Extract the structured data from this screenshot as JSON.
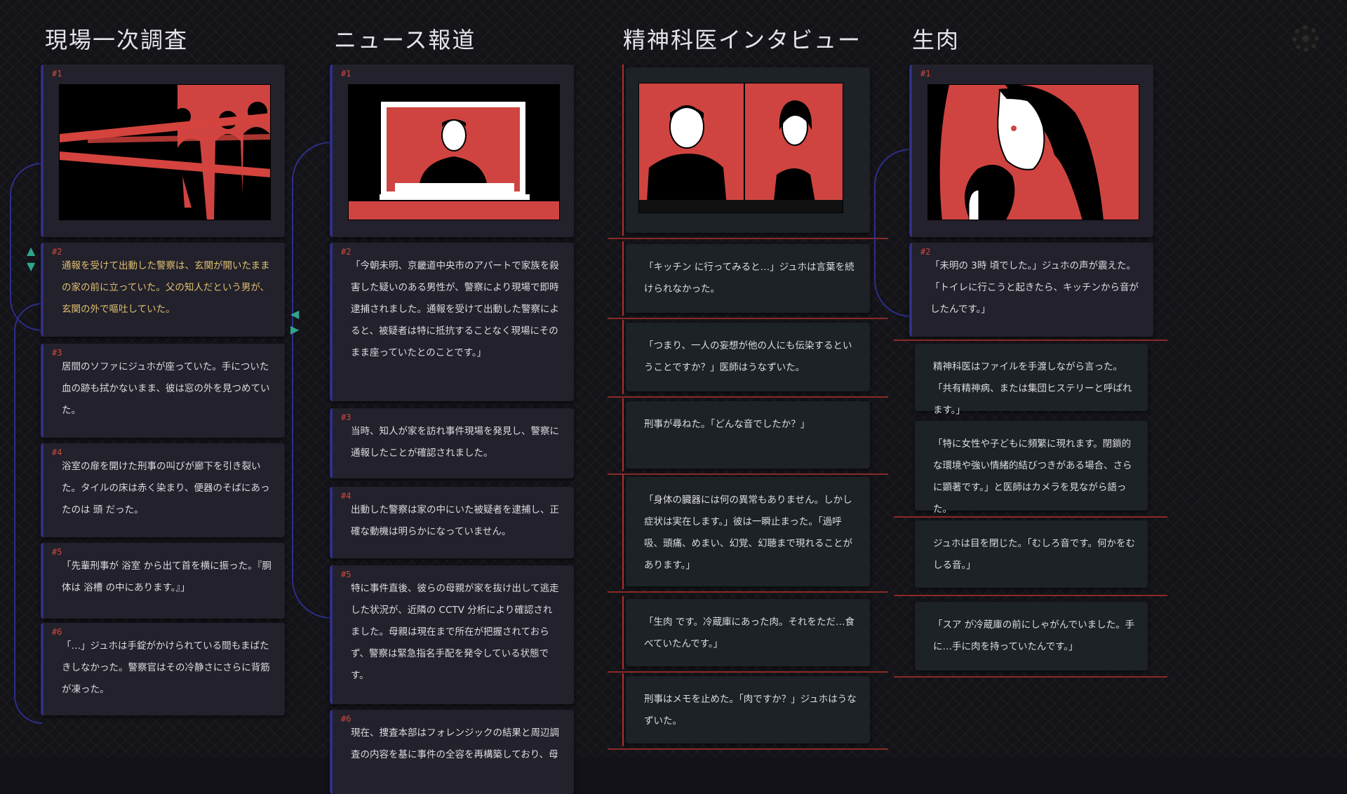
{
  "columns": [
    {
      "title": "現場一次調査",
      "image_label": "#1",
      "cards": [
        {
          "num": "#2",
          "text": "通報を受けて出動した警察は、玄関が開いたままの家の前に立っていた。父の知人だという男が、玄関の外で嘔吐していた。"
        },
        {
          "num": "#3",
          "text": "居間のソファにジュホが座っていた。手についた血の跡も拭かないまま、彼は窓の外を見つめていた。"
        },
        {
          "num": "#4",
          "text": "浴室の扉を開けた刑事の叫びが廊下を引き裂いた。タイルの床は赤く染まり、便器のそばにあったのは 頭 だった。"
        },
        {
          "num": "#5",
          "text": "「先輩刑事が 浴室 から出て首を横に振った。『胴体は 浴槽 の中にあります。』」"
        },
        {
          "num": "#6",
          "text": "「…」ジュホは手錠がかけられている間もまばたきしなかった。警察官はその冷静さにさらに背筋が凍った。"
        }
      ]
    },
    {
      "title": "ニュース報道",
      "image_label": "#1",
      "cards": [
        {
          "num": "#2",
          "text": "「今朝未明、京畿道中央市のアパートで家族を殺害した疑いのある男性が、警察により現場で即時逮捕されました。通報を受けて出動した警察によると、被疑者は特に抵抗することなく現場にそのまま座っていたとのことです。」"
        },
        {
          "num": "#3",
          "text": "当時、知人が家を訪れ事件現場を発見し、警察に通報したことが確認されました。"
        },
        {
          "num": "#4",
          "text": "出動した警察は家の中にいた被疑者を逮捕し、正確な動機は明らかになっていません。"
        },
        {
          "num": "#5",
          "text": "特に事件直後、彼らの母親が家を抜け出して逃走した状況が、近隣の CCTV 分析により確認されました。母親は現在まで所在が把握されておらず、警察は緊急指名手配を発令している状態です。"
        },
        {
          "num": "#6",
          "text": "現在、捜査本部はフォレンジックの結果と周辺調査の内容を基に事件の全容を再構築しており、母"
        }
      ]
    },
    {
      "title": "精神科医インタビュー",
      "cards": [
        {
          "text": "「キッチン に行ってみると…」ジュホは言葉を続けられなかった。"
        },
        {
          "text": "「つまり、一人の妄想が他の人にも伝染するということですか？」医師はうなずいた。"
        },
        {
          "text": "刑事が尋ねた。「どんな音でしたか？」"
        },
        {
          "text": "「身体の臓器には何の異常もありません。しかし症状は実在します。」彼は一瞬止まった。「過呼吸、頭痛、めまい、幻覚、幻聴まで現れることがあります。」"
        },
        {
          "text": "「生肉 です。冷蔵庫にあった肉。それをただ…食べていたんです。」"
        },
        {
          "text": "刑事はメモを止めた。「肉ですか？」ジュホはうなずいた。"
        }
      ]
    },
    {
      "title": "生肉",
      "image_label": "#1",
      "cards": [
        {
          "num": "#2",
          "text": "「未明の 3時 頃でした。」ジュホの声が震えた。「トイレに行こうと起きたら、キッチンから音がしたんです。」"
        },
        {
          "text": "精神科医はファイルを手渡しながら言った。「共有精神病、または集団ヒステリーと呼ばれます。」"
        },
        {
          "text": "「特に女性や子どもに頻繁に現れます。閉鎖的な環境や強い情緒的結びつきがある場合、さらに顕著です。」と医師はカメラを見ながら語った。"
        },
        {
          "text": "ジュホは目を閉じた。「むしろ音です。何かをむしる音。」"
        },
        {
          "text": "「スア が冷蔵庫の前にしゃがんでいました。手に…手に肉を持っていたんです。」"
        }
      ]
    }
  ],
  "icons": {
    "settings": "gear-icon",
    "move_up": "arrow-up-icon",
    "move_down": "arrow-down-icon",
    "move_left": "arrow-left-icon",
    "move_right": "arrow-right-icon"
  },
  "colors": {
    "accent_red": "#d04a3c",
    "highlight_orange": "#e06a3c",
    "highlight_yellow": "#e0c070",
    "link_blue": "#2e2e8a",
    "control_teal": "#2fa58c"
  }
}
